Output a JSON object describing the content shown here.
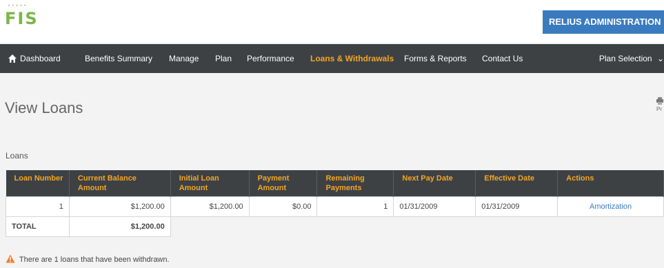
{
  "brand": {
    "logo_text": "FIS",
    "logo_dots": "• • • • •"
  },
  "header": {
    "relius_button": "RELIUS ADMINISTRATION"
  },
  "nav": {
    "items": [
      {
        "label": "Dashboard"
      },
      {
        "label": "Benefits Summary"
      },
      {
        "label": "Manage"
      },
      {
        "label": "Plan"
      },
      {
        "label": "Performance"
      },
      {
        "label": "Loans & Withdrawals",
        "active": true
      },
      {
        "label": "Forms & Reports"
      },
      {
        "label": "Contact Us"
      }
    ],
    "plan_selection": "Plan Selection"
  },
  "page": {
    "title": "View Loans",
    "print_label": "Pr"
  },
  "loans_section": {
    "label": "Loans",
    "columns": [
      "Loan Number",
      "Current Balance Amount",
      "Initial Loan Amount",
      "Payment Amount",
      "Remaining Payments",
      "Next Pay Date",
      "Effective Date",
      "Actions"
    ],
    "rows": [
      {
        "loan_number": "1",
        "current_balance": "$1,200.00",
        "initial_amount": "$1,200.00",
        "payment_amount": "$0.00",
        "remaining_payments": "1",
        "next_pay_date": "01/31/2009",
        "effective_date": "01/31/2009",
        "action": "Amortization"
      }
    ],
    "total": {
      "label": "TOTAL",
      "current_balance": "$1,200.00"
    }
  },
  "warning": {
    "text": "There are 1 loans that have been withdrawn."
  },
  "colors": {
    "nav_bg": "#3d4144",
    "accent_orange": "#f5a623",
    "brand_green": "#7ab648",
    "button_blue": "#3a7bbf"
  }
}
